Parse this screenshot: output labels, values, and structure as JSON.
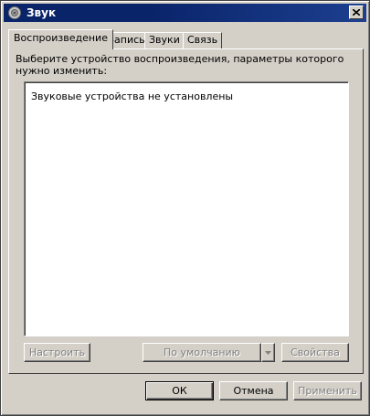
{
  "window": {
    "title": "Звук"
  },
  "tabs": [
    {
      "label": "Воспроизведение",
      "active": true
    },
    {
      "label": "Запись",
      "active": false
    },
    {
      "label": "Звуки",
      "active": false
    },
    {
      "label": "Связь",
      "active": false
    }
  ],
  "playback": {
    "instruction": "Выберите устройство воспроизведения, параметры которого нужно изменить:",
    "empty_message": "Звуковые устройства не установлены",
    "configure_label": "Настроить",
    "default_label": "По умолчанию",
    "properties_label": "Свойства"
  },
  "footer": {
    "ok_label": "ОК",
    "cancel_label": "Отмена",
    "apply_label": "Применить"
  },
  "colors": {
    "titlebar": "#0a246a",
    "face": "#d4d0c8",
    "disabled_text": "#808080"
  }
}
